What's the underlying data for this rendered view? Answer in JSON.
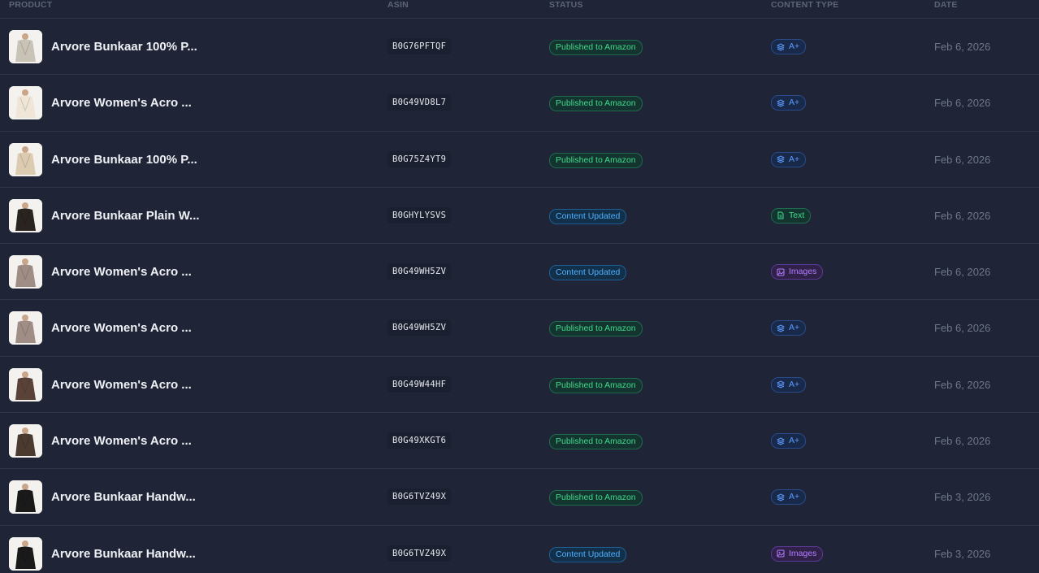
{
  "headers": {
    "product": "PRODUCT",
    "asin": "ASIN",
    "status": "STATUS",
    "content_type": "CONTENT TYPE",
    "date": "DATE"
  },
  "colors": {
    "background": "#1f2536",
    "published": "#3fd98c",
    "updated": "#4fb1ff",
    "aplus": "#5d9cff",
    "images": "#b57cff"
  },
  "rows": [
    {
      "name": "Arvore Bunkaar 100% P...",
      "asin": "B0G76PFTQF",
      "status": "Published to Amazon",
      "status_kind": "published",
      "content_type": "A+",
      "content_kind": "aplus",
      "content_icon": "layers-icon",
      "date": "Feb 6, 2026",
      "thumb_color": "#c9c2b6"
    },
    {
      "name": "Arvore Women's Acro ...",
      "asin": "B0G49VD8L7",
      "status": "Published to Amazon",
      "status_kind": "published",
      "content_type": "A+",
      "content_kind": "aplus",
      "content_icon": "layers-icon",
      "date": "Feb 6, 2026",
      "thumb_color": "#efe6d8"
    },
    {
      "name": "Arvore Bunkaar 100% P...",
      "asin": "B0G75Z4YT9",
      "status": "Published to Amazon",
      "status_kind": "published",
      "content_type": "A+",
      "content_kind": "aplus",
      "content_icon": "layers-icon",
      "date": "Feb 6, 2026",
      "thumb_color": "#dccbb0"
    },
    {
      "name": "Arvore Bunkaar Plain W...",
      "asin": "B0GHYLYSVS",
      "status": "Content Updated",
      "status_kind": "updated",
      "content_type": "Text",
      "content_kind": "text",
      "content_icon": "document-icon",
      "date": "Feb 6, 2026",
      "thumb_color": "#2a2420"
    },
    {
      "name": "Arvore Women's Acro ...",
      "asin": "B0G49WH5ZV",
      "status": "Content Updated",
      "status_kind": "updated",
      "content_type": "Images",
      "content_kind": "images",
      "content_icon": "image-icon",
      "date": "Feb 6, 2026",
      "thumb_color": "#a08e86"
    },
    {
      "name": "Arvore Women's Acro ...",
      "asin": "B0G49WH5ZV",
      "status": "Published to Amazon",
      "status_kind": "published",
      "content_type": "A+",
      "content_kind": "aplus",
      "content_icon": "layers-icon",
      "date": "Feb 6, 2026",
      "thumb_color": "#a08e86"
    },
    {
      "name": "Arvore Women's Acro ...",
      "asin": "B0G49W44HF",
      "status": "Published to Amazon",
      "status_kind": "published",
      "content_type": "A+",
      "content_kind": "aplus",
      "content_icon": "layers-icon",
      "date": "Feb 6, 2026",
      "thumb_color": "#5a4238"
    },
    {
      "name": "Arvore Women's Acro ...",
      "asin": "B0G49XKGT6",
      "status": "Published to Amazon",
      "status_kind": "published",
      "content_type": "A+",
      "content_kind": "aplus",
      "content_icon": "layers-icon",
      "date": "Feb 6, 2026",
      "thumb_color": "#4a3a30"
    },
    {
      "name": "Arvore Bunkaar Handw...",
      "asin": "B0G6TVZ49X",
      "status": "Published to Amazon",
      "status_kind": "published",
      "content_type": "A+",
      "content_kind": "aplus",
      "content_icon": "layers-icon",
      "date": "Feb 3, 2026",
      "thumb_color": "#1a1a1a"
    },
    {
      "name": "Arvore Bunkaar Handw...",
      "asin": "B0G6TVZ49X",
      "status": "Content Updated",
      "status_kind": "updated",
      "content_type": "Images",
      "content_kind": "images",
      "content_icon": "image-icon",
      "date": "Feb 3, 2026",
      "thumb_color": "#1a1a1a"
    }
  ]
}
